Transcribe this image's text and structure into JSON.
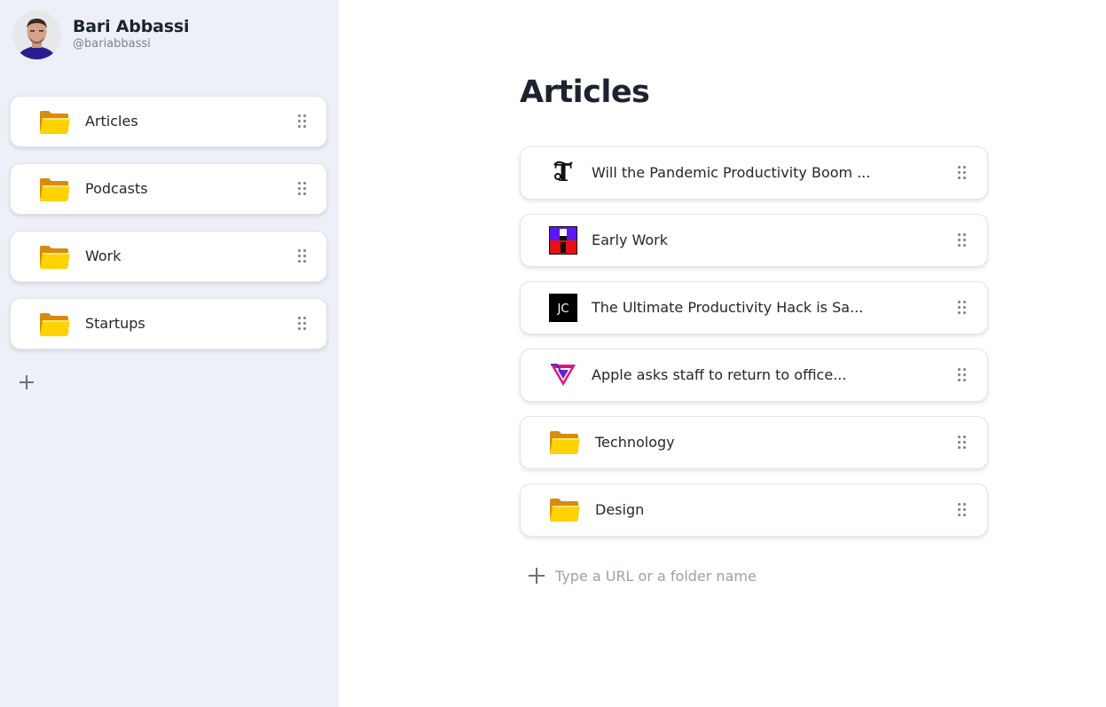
{
  "profile": {
    "name": "Bari Abbassi",
    "handle": "@bariabbassi"
  },
  "sidebar": {
    "items": [
      {
        "label": "Articles",
        "icon": "folder-icon"
      },
      {
        "label": "Podcasts",
        "icon": "folder-icon"
      },
      {
        "label": "Work",
        "icon": "folder-icon"
      },
      {
        "label": "Startups",
        "icon": "folder-icon"
      }
    ],
    "add_icon": "plus-icon"
  },
  "main": {
    "title": "Articles",
    "items": [
      {
        "label": "Will the Pandemic Productivity Boom ...",
        "icon": "nytimes-favicon"
      },
      {
        "label": "Early Work",
        "icon": "early-work-favicon"
      },
      {
        "label": "The Ultimate Productivity Hack is Sa...",
        "icon": "jc-favicon",
        "icon_text": "JC"
      },
      {
        "label": "Apple asks staff to return to office...",
        "icon": "the-verge-favicon"
      },
      {
        "label": "Technology",
        "icon": "folder-icon"
      },
      {
        "label": "Design",
        "icon": "folder-icon"
      }
    ],
    "add": {
      "placeholder": "Type a URL or a folder name",
      "icon": "plus-icon"
    }
  },
  "colors": {
    "sidebar_bg": "#edf0f6",
    "card_bg": "#ffffff",
    "folder_yellow": "#ffd200",
    "text": "#23262d",
    "muted": "#9aa0aa"
  }
}
